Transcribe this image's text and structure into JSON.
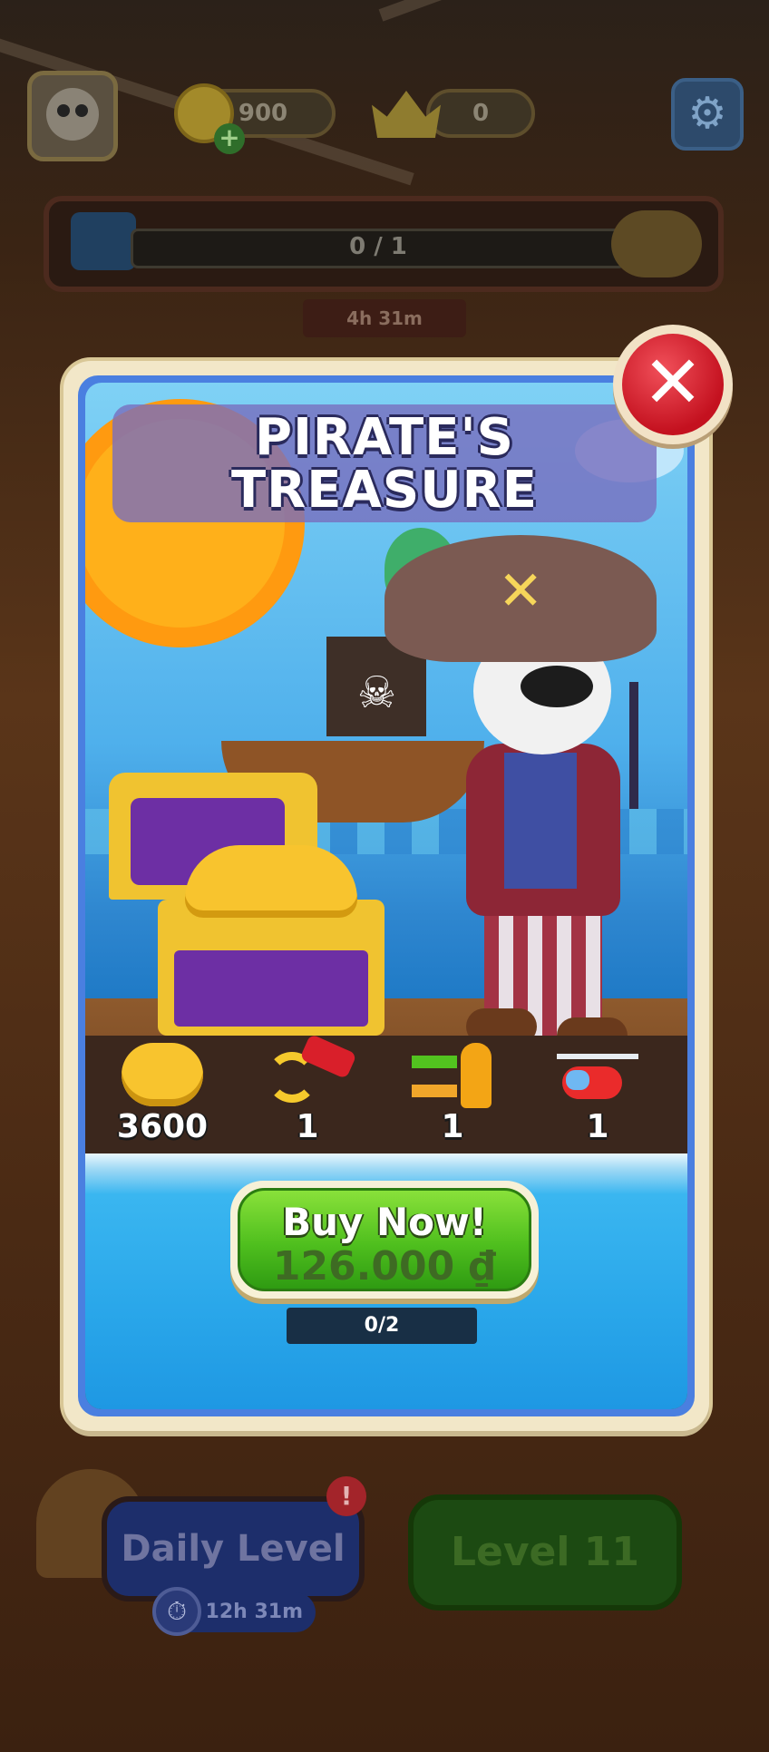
{
  "hud": {
    "coins": "900",
    "crowns": "0",
    "progress": "0 / 1",
    "progress_fraction": 0,
    "event_timer": "4h 31m",
    "icons": {
      "avatar": "panda-avatar-icon",
      "coin": "coin-icon",
      "add": "plus-icon",
      "crown": "crown-icon",
      "settings": "gear-icon",
      "bus": "bus-icon",
      "reward": "treasure-icon"
    }
  },
  "offer": {
    "title_line1": "PIRATE'S",
    "title_line2": "TREASURE",
    "rewards": [
      {
        "icon": "coins-pile-icon",
        "count": "3600"
      },
      {
        "icon": "swap-car-icon",
        "count": "1"
      },
      {
        "icon": "swap-person-icon",
        "count": "1"
      },
      {
        "icon": "helicopter-icon",
        "count": "1"
      }
    ],
    "buy_label": "Buy Now!",
    "price": "126.000 ₫",
    "purchase_count": "0/2",
    "close_icon": "close-icon"
  },
  "bottom": {
    "daily_label": "Daily Level",
    "daily_timer": "12h 31m",
    "daily_alert": "!",
    "level_label": "Level 11"
  },
  "colors": {
    "buy_green": "#4fbf1e",
    "close_red": "#c4111f",
    "card_border": "#f2e7c8",
    "card_blue": "#4a7fe0"
  }
}
